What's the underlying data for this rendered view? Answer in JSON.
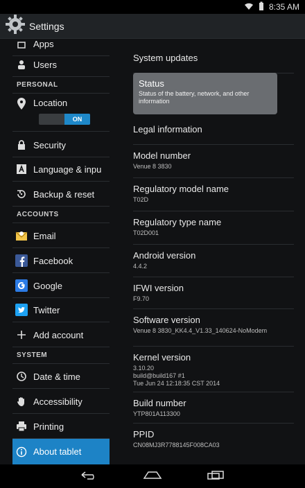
{
  "status_bar": {
    "time": "8:35 AM"
  },
  "app": {
    "title": "Settings"
  },
  "left_menu": {
    "apps": "Apps",
    "users": "Users",
    "personal_section": "PERSONAL",
    "location": "Location",
    "location_toggle": "ON",
    "security": "Security",
    "language": "Language & inpu",
    "backup": "Backup & reset",
    "accounts_section": "ACCOUNTS",
    "email": "Email",
    "facebook": "Facebook",
    "google": "Google",
    "twitter": "Twitter",
    "add_account": "Add account",
    "system_section": "SYSTEM",
    "date_time": "Date & time",
    "accessibility": "Accessibility",
    "printing": "Printing",
    "about": "About tablet"
  },
  "right_panel": {
    "system_updates": "System updates",
    "status_title": "Status",
    "status_desc": "Status of the battery, network, and other information",
    "legal": "Legal information",
    "model_number_label": "Model number",
    "model_number_value": "Venue 8 3830",
    "reg_model_label": "Regulatory model name",
    "reg_model_value": "T02D",
    "reg_type_label": "Regulatory type name",
    "reg_type_value": "T02D001",
    "android_label": "Android version",
    "android_value": "4.4.2",
    "ifwi_label": "IFWI version",
    "ifwi_value": "F9.70",
    "software_label": "Software version",
    "software_value": "Venue 8 3830_KK4.4_V1.33_140624-NoModem",
    "kernel_label": "Kernel version",
    "kernel_value": "3.10.20\nbuild@build167 #1\nTue Jun 24 12:18:35 CST 2014",
    "build_label": "Build number",
    "build_value": "YTP801A113300",
    "ppid_label": "PPID",
    "ppid_value": "CN08MJ3R7788145F008CA03"
  }
}
